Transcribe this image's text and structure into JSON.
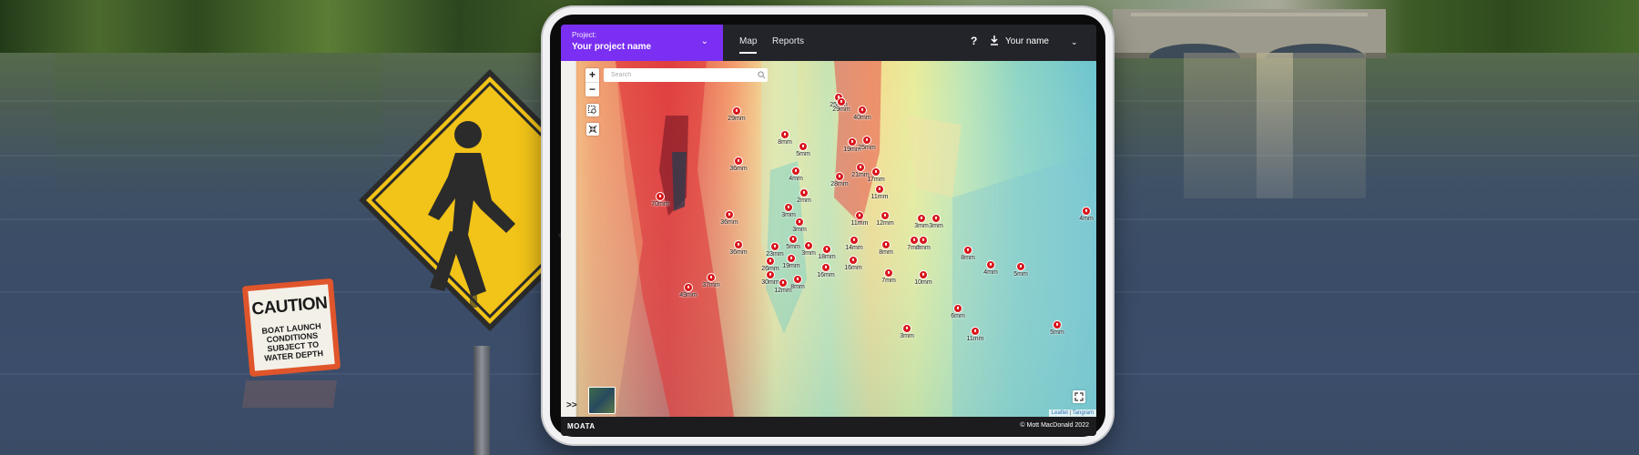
{
  "caution_sign": {
    "title": "CAUTION",
    "message": "BOAT LAUNCH CONDITIONS SUBJECT TO WATER DEPTH"
  },
  "app": {
    "project_label": "Project:",
    "project_name": "Your project name",
    "tabs": [
      {
        "label": "Map",
        "active": true
      },
      {
        "label": "Reports",
        "active": false
      }
    ],
    "help_label": "?",
    "user_name": "Your name",
    "accent_color": "#7b2ff2"
  },
  "map": {
    "search_placeholder": "Search",
    "zoom_in": "+",
    "zoom_out": "−",
    "expand_label": ">>",
    "attribution_leaflet": "Leaflet",
    "attribution_sep": " | ",
    "attribution_tangram": "Tangram",
    "pin_color": "#d8161c",
    "pins": [
      {
        "label": "29mm"
      },
      {
        "label": "25mm"
      },
      {
        "label": "40mm"
      },
      {
        "label": "29mm"
      },
      {
        "label": "8mm"
      },
      {
        "label": "5mm"
      },
      {
        "label": "19mm"
      },
      {
        "label": "25mm"
      },
      {
        "label": "36mm"
      },
      {
        "label": "4mm"
      },
      {
        "label": "28mm"
      },
      {
        "label": "21mm"
      },
      {
        "label": "17mm"
      },
      {
        "label": "11mm"
      },
      {
        "label": "70mm"
      },
      {
        "label": "2mm"
      },
      {
        "label": "36mm"
      },
      {
        "label": "3mm"
      },
      {
        "label": "3mm"
      },
      {
        "label": "11mm"
      },
      {
        "label": "12mm"
      },
      {
        "label": "3mm"
      },
      {
        "label": "3mm"
      },
      {
        "label": "4mm"
      },
      {
        "label": "36mm"
      },
      {
        "label": "5mm"
      },
      {
        "label": "23mm"
      },
      {
        "label": "3mm"
      },
      {
        "label": "18mm"
      },
      {
        "label": "14mm"
      },
      {
        "label": "8mm"
      },
      {
        "label": "3mm"
      },
      {
        "label": "7mm"
      },
      {
        "label": "8mm"
      },
      {
        "label": "26mm"
      },
      {
        "label": "19mm"
      },
      {
        "label": "16mm"
      },
      {
        "label": "16mm"
      },
      {
        "label": "37mm"
      },
      {
        "label": "30mm"
      },
      {
        "label": "12mm"
      },
      {
        "label": "8mm"
      },
      {
        "label": "49mm"
      },
      {
        "label": "7mm"
      },
      {
        "label": "10mm"
      },
      {
        "label": "4mm"
      },
      {
        "label": "5mm"
      },
      {
        "label": "6mm"
      },
      {
        "label": "3mm"
      },
      {
        "label": "11mm"
      },
      {
        "label": "5mm"
      }
    ]
  },
  "footer": {
    "brand": "MOATA",
    "copyright": "© Mott MacDonald 2022"
  }
}
